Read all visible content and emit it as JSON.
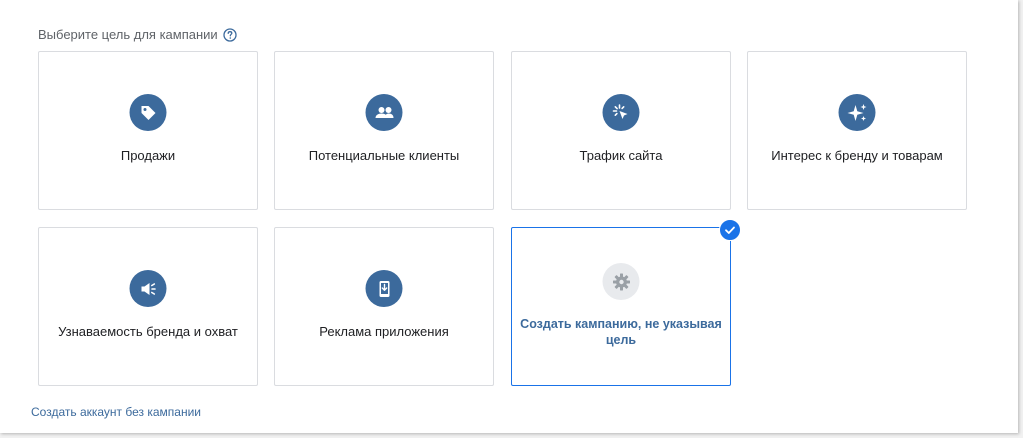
{
  "heading": "Выберите цель для кампании",
  "goals": [
    {
      "label": "Продажи",
      "icon": "tag-icon"
    },
    {
      "label": "Потенциальные клиенты",
      "icon": "people-icon"
    },
    {
      "label": "Трафик сайта",
      "icon": "cursor-click-icon"
    },
    {
      "label": "Интерес к бренду и товарам",
      "icon": "sparkle-icon"
    },
    {
      "label": "Узнаваемость бренда и охват",
      "icon": "speaker-icon"
    },
    {
      "label": "Реклама приложения",
      "icon": "phone-download-icon"
    },
    {
      "label": "Создать кампанию, не указывая цель",
      "icon": "gear-icon",
      "selected": true
    }
  ],
  "footer_link": "Создать аккаунт без кампании",
  "colors": {
    "icon_bg": "#3c6a9c",
    "selected_border": "#1a73e8",
    "link": "#3c6a9c"
  }
}
